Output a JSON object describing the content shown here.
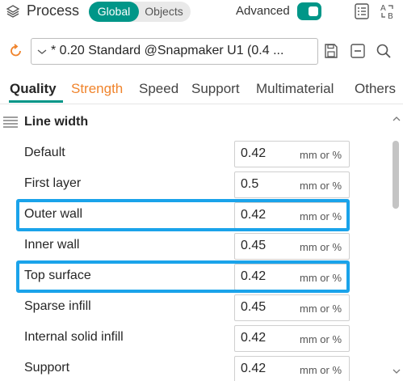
{
  "header": {
    "title": "Process",
    "scope_toggle": {
      "global_label": "Global",
      "objects_label": "Objects",
      "selected": "Global"
    },
    "advanced_label": "Advanced",
    "advanced_on": true,
    "icons": [
      "layers-icon",
      "compare-list-icon",
      "text-ab-icon"
    ]
  },
  "preset": {
    "name": "* 0.20 Standard @Snapmaker U1 (0.4 ...",
    "icons": [
      "reset-icon",
      "chevron-down-icon",
      "save-icon",
      "remove-icon",
      "search-icon"
    ]
  },
  "tabs": [
    {
      "label": "Quality",
      "active": true,
      "modified": false
    },
    {
      "label": "Strength",
      "active": false,
      "modified": true
    },
    {
      "label": "Speed",
      "active": false,
      "modified": false
    },
    {
      "label": "Support",
      "active": false,
      "modified": false
    },
    {
      "label": "Multimaterial",
      "active": false,
      "modified": false
    },
    {
      "label": "Others",
      "active": false,
      "modified": false
    }
  ],
  "section": {
    "title": "Line width",
    "icon": "line-width-icon"
  },
  "rows": [
    {
      "label": "Default",
      "value": "0.42",
      "unit": "mm or %",
      "highlighted": false
    },
    {
      "label": "First layer",
      "value": "0.5",
      "unit": "mm or %",
      "highlighted": false
    },
    {
      "label": "Outer wall",
      "value": "0.42",
      "unit": "mm or %",
      "highlighted": true
    },
    {
      "label": "Inner wall",
      "value": "0.45",
      "unit": "mm or %",
      "highlighted": false
    },
    {
      "label": "Top surface",
      "value": "0.42",
      "unit": "mm or %",
      "highlighted": true
    },
    {
      "label": "Sparse infill",
      "value": "0.45",
      "unit": "mm or %",
      "highlighted": false
    },
    {
      "label": "Internal solid infill",
      "value": "0.42",
      "unit": "mm or %",
      "highlighted": false
    },
    {
      "label": "Support",
      "value": "0.42",
      "unit": "mm or %",
      "highlighted": false
    }
  ],
  "colors": {
    "accent": "#009688",
    "modified_tab": "#f0842c",
    "highlight_box": "#1aa3ea"
  }
}
